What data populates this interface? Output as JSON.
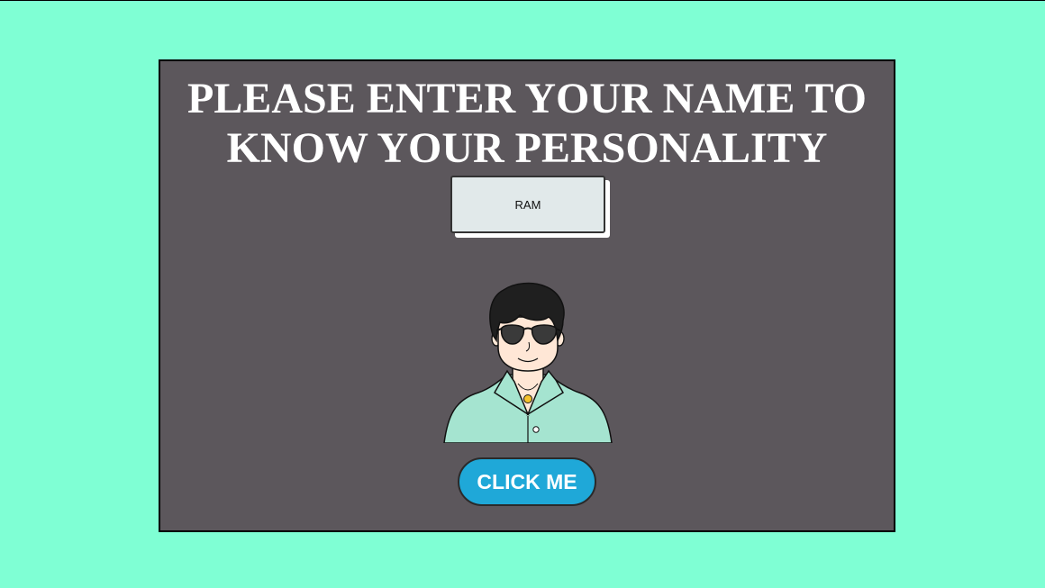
{
  "page": {
    "background_color": "#7fffd4"
  },
  "card": {
    "background_color": "#5c575c",
    "title_line1": "PLEASE ENTER YOUR NAME TO",
    "title_line2": "KNOW YOUR PERSONALITY"
  },
  "name_input": {
    "value": "RAM"
  },
  "avatar": {
    "icon": "man-with-sunglasses-avatar"
  },
  "button": {
    "label": "CLICK ME",
    "color": "#1fa8d8"
  }
}
